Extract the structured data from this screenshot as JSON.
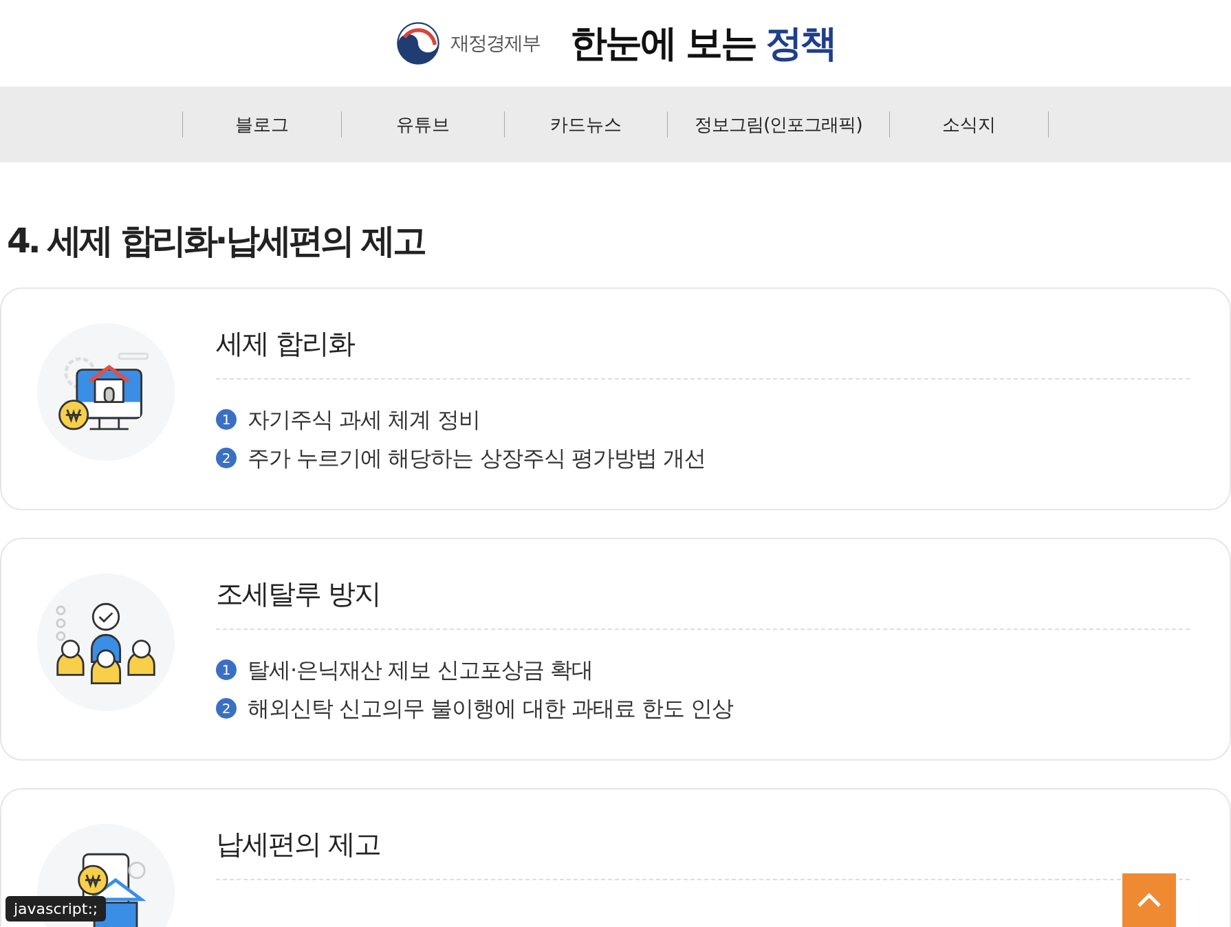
{
  "header": {
    "ministry": "재정경제부",
    "title": "한눈에 보는",
    "title_highlight": "정책"
  },
  "nav": {
    "items": [
      {
        "label": "블로그"
      },
      {
        "label": "유튜브"
      },
      {
        "label": "카드뉴스"
      },
      {
        "label": "정보그림(인포그래픽)"
      },
      {
        "label": "소식지"
      }
    ]
  },
  "section": {
    "heading": "4. 세제 합리화·납세편의 제고",
    "cards": [
      {
        "kind": "monitor",
        "title": "세제 합리화",
        "items": [
          {
            "number": "1",
            "text": "자기주식 과세 체계 정비"
          },
          {
            "number": "2",
            "text": "주가 누르기에 해당하는 상장주식 평가방법 개선"
          }
        ]
      },
      {
        "kind": "people",
        "title": "조세탈루 방지",
        "items": [
          {
            "number": "1",
            "text": "탈세·은닉재산 제보 신고포상금 확대"
          },
          {
            "number": "2",
            "text": "해외신탁 신고의무 불이행에 대한 과태료 한도 인상"
          }
        ]
      },
      {
        "kind": "bank",
        "title": "납세편의 제고"
      }
    ]
  },
  "status_link": "javascript:;"
}
